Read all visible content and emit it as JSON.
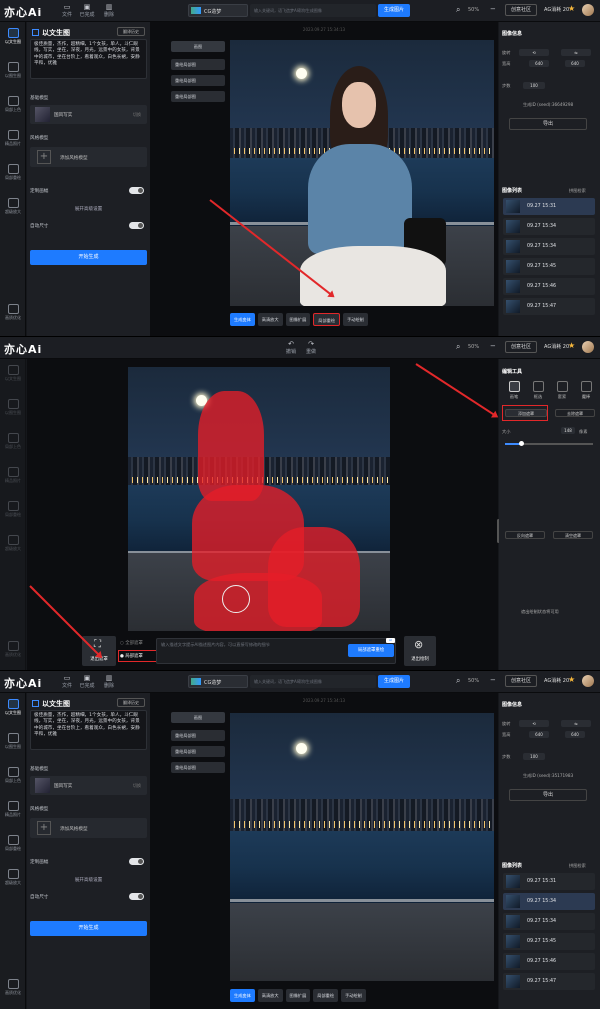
{
  "app": {
    "logo": "亦心Ai"
  },
  "topbar": {
    "buttons": [
      "文件",
      "已完成",
      "删除"
    ],
    "model": "CG造梦",
    "prompt_placeholder": "输入关键词，语飞造梦AI帮你生成图像",
    "generate": "生成图片",
    "zoom": "50%",
    "community": "创意社区",
    "ag": "AG消耗 20"
  },
  "rail": {
    "items": [
      "以文生图",
      "以图生图",
      "局部上色",
      "精品照片",
      "局部重绘",
      "超级放大"
    ],
    "bottom": "画质优化"
  },
  "left": {
    "title": "以文生图",
    "tag": "翻译历史",
    "prompt": "极佳质量，杰作，超精细，1个女孩，单人，斗仁眼线，写实，坐在，深夜，月光，远景中的女孩，背景中的城市，坐在台阶上，看着观众，白色长裙，安静平和，优雅",
    "model_label": "基础模型",
    "model_name": "国风写实",
    "model_action": "切换",
    "lora_label": "风格模型",
    "lora_add": "添加风格模型",
    "custom_size": "定制画幅",
    "expand": "展开高级设置",
    "auto_size": "自动尺寸",
    "start": "开始生成"
  },
  "canvas": {
    "timestamp": "2023.09.27 15:34:13",
    "history": [
      "画图",
      "重绘局部图",
      "重绘局部图",
      "重绘局部图"
    ],
    "bottom_s1": [
      "生成变体",
      "高清放大",
      "图像扩展",
      "局部重绘",
      "手动绘制"
    ],
    "bottom_s3": [
      "生成变体",
      "高清放大",
      "图像扩展",
      "局部重绘",
      "手动绘制"
    ],
    "undo": "撤销",
    "redo": "重做"
  },
  "right": {
    "info_title": "图像信息",
    "rotate": "旋转",
    "width_label": "宽高",
    "width": "640",
    "height": "640",
    "step_label": "步数",
    "step": "100",
    "seed_label": "生成ID (seed):",
    "seed_s1": "36649298",
    "seed_s3": "35171983",
    "export": "导出",
    "list_title": "图像列表",
    "list_action": "拼图检索",
    "list": [
      "09.27 15:31",
      "09.27 15:34",
      "09.27 15:34",
      "09.27 15:45",
      "09.27 15:46",
      "09.27 15:47"
    ]
  },
  "mask_editor": {
    "tools_title": "编辑工具",
    "tools": [
      "画笔",
      "框选",
      "套索",
      "魔棒"
    ],
    "add_mask": "添加遮罩",
    "remove_mask": "去除遮罩",
    "size_label": "大小",
    "size_value": "148",
    "size_unit": "像素",
    "invert": "反向遮罩",
    "clear": "清空遮罩",
    "empty_hint": "遮出绘制状态将可用",
    "exit_mask": "退出遮罩",
    "opt_a": "全部遮罩",
    "opt_b": "局部遮罩",
    "prompt_hint": "输入描述文字提示AI描述图片内容，可以直接写修改的细节",
    "apply": "局部遮罩重绘",
    "exit_draw": "退出绘制",
    "ai_badge": "AI"
  },
  "colors": {
    "accent": "#1e7bff",
    "highlight": "#e2282a",
    "mask": "#e61e28"
  }
}
